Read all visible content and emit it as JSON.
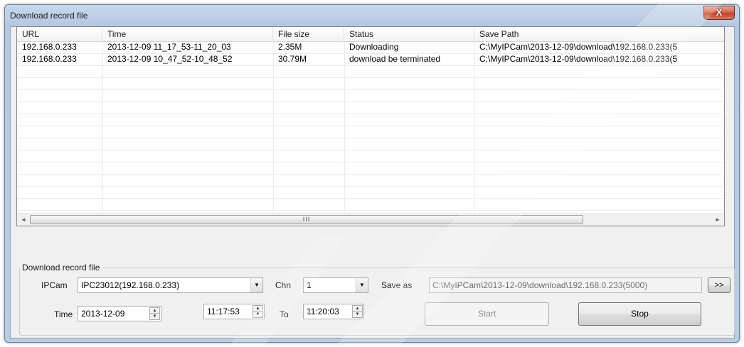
{
  "window": {
    "title": "Download record file",
    "close_label": "X"
  },
  "list": {
    "columns": [
      "URL",
      "Time",
      "File size",
      "Status",
      "Save Path"
    ],
    "rows": [
      {
        "url": "192.168.0.233",
        "time": "2013-12-09 11_17_53-11_20_03",
        "size": "2.35M",
        "status": "Downloading",
        "path": "C:\\MyIPCam\\2013-12-09\\download\\192.168.0.233(5"
      },
      {
        "url": "192.168.0.233",
        "time": "2013-12-09 10_47_52-10_48_52",
        "size": "30.79M",
        "status": "download be terminated",
        "path": "C:\\MyIPCam\\2013-12-09\\download\\192.168.0.233(5"
      }
    ],
    "scroll_grip": "III",
    "scroll_left": "◄",
    "scroll_right": "►"
  },
  "form": {
    "group_title": "Download record file",
    "ipcam_label": "IPCam",
    "ipcam_value": "IPC23012(192.168.0.233)",
    "chn_label": "Chn",
    "chn_value": "1",
    "saveas_label": "Save as",
    "saveas_value": "C:\\MyIPCam\\2013-12-09\\download\\192.168.0.233(5000)",
    "browse_label": ">>",
    "time_label": "Time",
    "date_value": "2013-12-09",
    "start_time_value": "11:17:53",
    "to_label": "To",
    "end_time_value": "11:20:03",
    "start_label": "Start",
    "stop_label": "Stop"
  }
}
